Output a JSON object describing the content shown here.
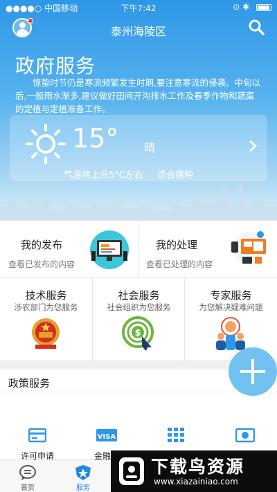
{
  "status": {
    "carrier": "中国移动",
    "time": "下午7:42"
  },
  "nav": {
    "title": "泰州海陵区"
  },
  "hero": {
    "title": "政府服务",
    "notice": "惊蛰时节仍是寒流频繁发生时期,要注意寒流的侵袭。中旬以后,一般雨水渐多,建议做好田间开沟排水工作及春季作物和蔬菜的定植与定植准备工作。"
  },
  "weather": {
    "temperature": "15°",
    "condition": "晴",
    "tip1": "气温将上升5°C左右",
    "tip2": "适合播种"
  },
  "services_top": [
    {
      "title": "我的发布",
      "subtitle": "查看已发布的内容"
    },
    {
      "title": "我的处理",
      "subtitle": "查看已处理的内容"
    }
  ],
  "services_mid": [
    {
      "title": "技术服务",
      "subtitle": "涉农部门为您服务"
    },
    {
      "title": "社会服务",
      "subtitle": "社会组织为您服务"
    },
    {
      "title": "专家服务",
      "subtitle": "为您解决疑难问题"
    }
  ],
  "policy": {
    "title": "政策服务"
  },
  "quick_items": [
    {
      "label": "许可申请",
      "icon": "card-icon"
    },
    {
      "label": "金融保",
      "icon": "visa-icon"
    },
    {
      "label": "",
      "icon": "grid-icon"
    },
    {
      "label": "",
      "icon": "money-icon"
    }
  ],
  "tabs": [
    {
      "label": "首页",
      "icon": "message-icon"
    },
    {
      "label": "服务",
      "icon": "star-badge-icon"
    }
  ],
  "watermark": {
    "title": "下载鸟资源",
    "url": "www.xiazainiao.com"
  },
  "colors": {
    "primary": "#2d97e8",
    "fab": "#72c2f1",
    "accent_red": "#e53935"
  }
}
